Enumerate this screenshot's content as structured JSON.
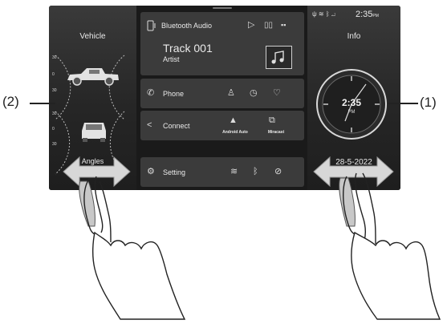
{
  "left_panel": {
    "title": "Vehicle",
    "footer_label": "Angles",
    "degree_ticks": [
      "30",
      "0",
      "30",
      "30",
      "0",
      "30"
    ]
  },
  "media": {
    "source_label": "Bluetooth Audio",
    "track": "Track 001",
    "artist": "Artist"
  },
  "menu": {
    "phone_label": "Phone",
    "connect_label": "Connect",
    "android_auto_label": "Android Auto",
    "miracast_label": "Miracast",
    "setting_label": "Setting"
  },
  "right_panel": {
    "status_time": "2:35",
    "status_ampm": "PM",
    "title": "Info",
    "clock_time": "2:35",
    "clock_ampm": "PM",
    "date": "28-5-2022"
  },
  "callouts": {
    "left": "(2)",
    "right": "(1)"
  },
  "colors": {
    "screen_bg": "#1a1a1a",
    "tile_bg": "#3b3b3b",
    "text": "#eaeaea"
  }
}
